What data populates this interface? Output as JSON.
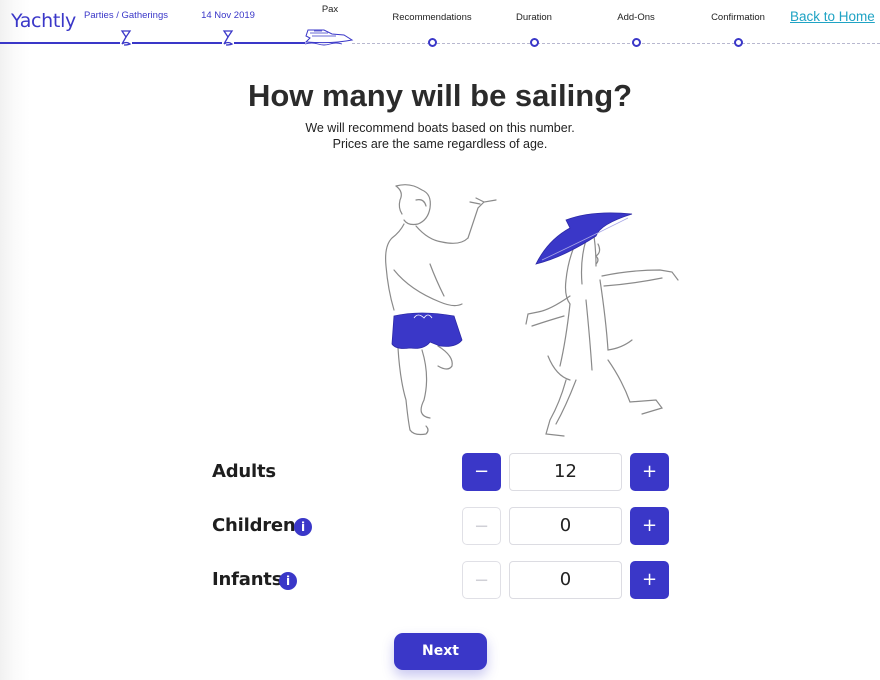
{
  "header": {
    "logo": "Yachtly",
    "steps": [
      {
        "label": "Parties / Gatherings",
        "state": "done",
        "icon": "hourglass-icon"
      },
      {
        "label": "14 Nov 2019",
        "state": "done",
        "icon": "hourglass-icon"
      },
      {
        "label": "Pax",
        "state": "current",
        "icon": "yacht-icon"
      },
      {
        "label": "Recommendations",
        "state": "upcoming",
        "icon": "step-dot-icon"
      },
      {
        "label": "Duration",
        "state": "upcoming",
        "icon": "step-dot-icon"
      },
      {
        "label": "Add-Ons",
        "state": "upcoming",
        "icon": "step-dot-icon"
      },
      {
        "label": "Confirmation",
        "state": "upcoming",
        "icon": "step-dot-icon"
      }
    ],
    "back_link": "Back to Home"
  },
  "main": {
    "title": "How many will be sailing?",
    "subtitle_line1": "We will recommend boats based on this number.",
    "subtitle_line2": "Prices are the same regardless of age.",
    "illustration": "two-people-dancing-illustration",
    "counters": [
      {
        "label": "Adults",
        "value": "12",
        "has_info": false,
        "minus_enabled": true,
        "plus_enabled": true,
        "minus_symbol": "−",
        "plus_symbol": "+"
      },
      {
        "label": "Children",
        "value": "0",
        "has_info": true,
        "info_symbol": "i",
        "minus_enabled": false,
        "plus_enabled": true,
        "minus_symbol": "−",
        "plus_symbol": "+"
      },
      {
        "label": "Infants",
        "value": "0",
        "has_info": true,
        "info_symbol": "i",
        "minus_enabled": false,
        "plus_enabled": true,
        "minus_symbol": "−",
        "plus_symbol": "+"
      }
    ],
    "next_label": "Next"
  },
  "colors": {
    "accent": "#3a37c8",
    "link": "#1fa3c4",
    "text": "#222222",
    "disabled_border": "#e0e0e6"
  }
}
